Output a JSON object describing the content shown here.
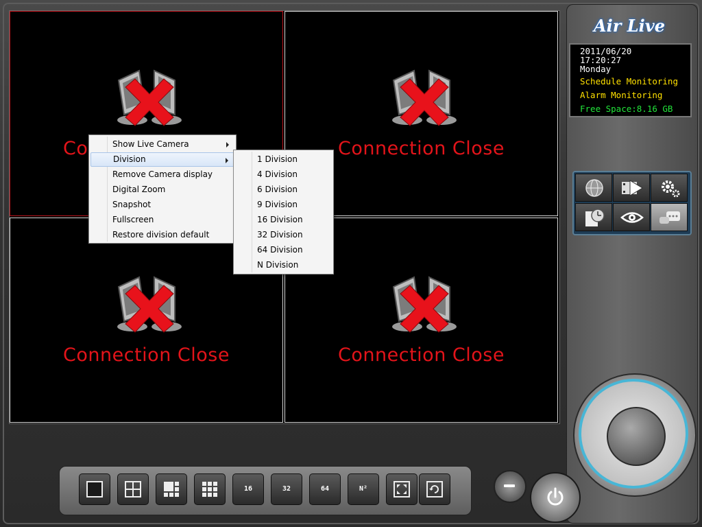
{
  "app": {
    "logo": "Air Live"
  },
  "cameras": [
    {
      "status": "Connection Close",
      "selected": true
    },
    {
      "status": "Connection Close",
      "selected": false
    },
    {
      "status": "Connection Close",
      "selected": false
    },
    {
      "status": "Connection Close",
      "selected": false
    }
  ],
  "info": {
    "date": "2011/06/20",
    "time": "17:20:27",
    "day": "Monday",
    "schedule": "Schedule Monitoring",
    "alarm": "Alarm Monitoring",
    "free_space": "Free Space:8.16 GB"
  },
  "context_menu": {
    "items": [
      {
        "label": "Show Live Camera",
        "submenu": true
      },
      {
        "label": "Division",
        "submenu": true,
        "highlighted": true
      },
      {
        "label": "Remove Camera display"
      },
      {
        "label": "Digital Zoom"
      },
      {
        "label": "Snapshot"
      },
      {
        "label": "Fullscreen"
      },
      {
        "label": "Restore division default"
      }
    ]
  },
  "division_menu": {
    "items": [
      "1 Division",
      "4 Division",
      "6 Division",
      "9 Division",
      "16 Division",
      "32 Division",
      "64 Division",
      "N Division"
    ]
  },
  "panel_buttons": [
    {
      "icon": "globe-icon"
    },
    {
      "icon": "playback-icon"
    },
    {
      "icon": "settings-icon"
    },
    {
      "icon": "schedule-clock-icon"
    },
    {
      "icon": "eye-icon"
    },
    {
      "icon": "chat-icon",
      "active": true
    }
  ],
  "toolbar": {
    "buttons": [
      {
        "icon": "layout-1-icon",
        "label": ""
      },
      {
        "icon": "layout-4-icon",
        "label": ""
      },
      {
        "icon": "layout-6-icon",
        "label": ""
      },
      {
        "icon": "layout-9-icon",
        "label": ""
      },
      {
        "icon": "layout-16-icon",
        "label": "16"
      },
      {
        "icon": "layout-32-icon",
        "label": "32"
      },
      {
        "icon": "layout-64-icon",
        "label": "64"
      },
      {
        "icon": "layout-n-icon",
        "label": "N²"
      },
      {
        "icon": "fullscreen-icon",
        "label": ""
      },
      {
        "icon": "auto-rotate-icon",
        "label": ""
      }
    ]
  },
  "colors": {
    "status_text": "#e3141a",
    "schedule_text": "#ffe000",
    "free_space_text": "#22e53a",
    "selected_border": "#c0141c",
    "dial_ring": "#48b6d6"
  }
}
